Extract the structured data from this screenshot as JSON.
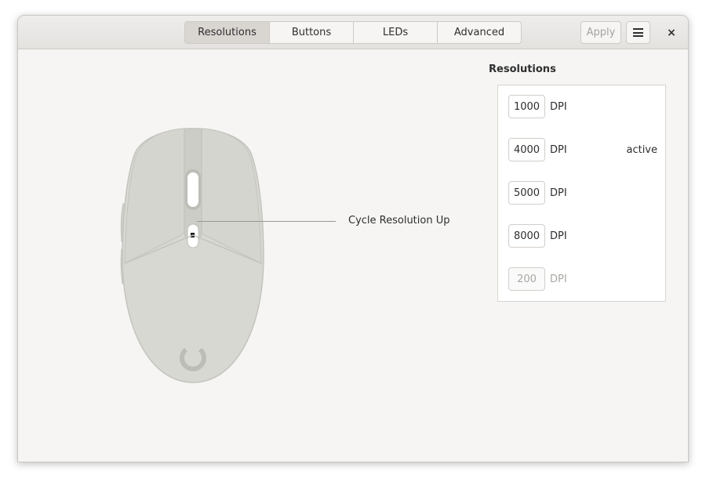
{
  "header": {
    "tabs": [
      {
        "label": "Resolutions",
        "active": true
      },
      {
        "label": "Buttons",
        "active": false
      },
      {
        "label": "LEDs",
        "active": false
      },
      {
        "label": "Advanced",
        "active": false
      }
    ],
    "apply_label": "Apply",
    "menu_icon": "hamburger-menu-icon",
    "close_label": "×"
  },
  "device": {
    "callout": "Cycle Resolution Up",
    "logo_icon": "device-logo-icon"
  },
  "resolutions": {
    "title": "Resolutions",
    "rows": [
      {
        "value": "1000",
        "unit": "DPI",
        "status": "",
        "enabled": true
      },
      {
        "value": "4000",
        "unit": "DPI",
        "status": "active",
        "enabled": true
      },
      {
        "value": "5000",
        "unit": "DPI",
        "status": "",
        "enabled": true
      },
      {
        "value": "8000",
        "unit": "DPI",
        "status": "",
        "enabled": true
      },
      {
        "value": "200",
        "unit": "DPI",
        "status": "",
        "enabled": false
      }
    ]
  },
  "colors": {
    "window_bg": "#f6f5f4",
    "active_tab": "#d9d6d2",
    "mouse_body": "#d8d8d3"
  }
}
